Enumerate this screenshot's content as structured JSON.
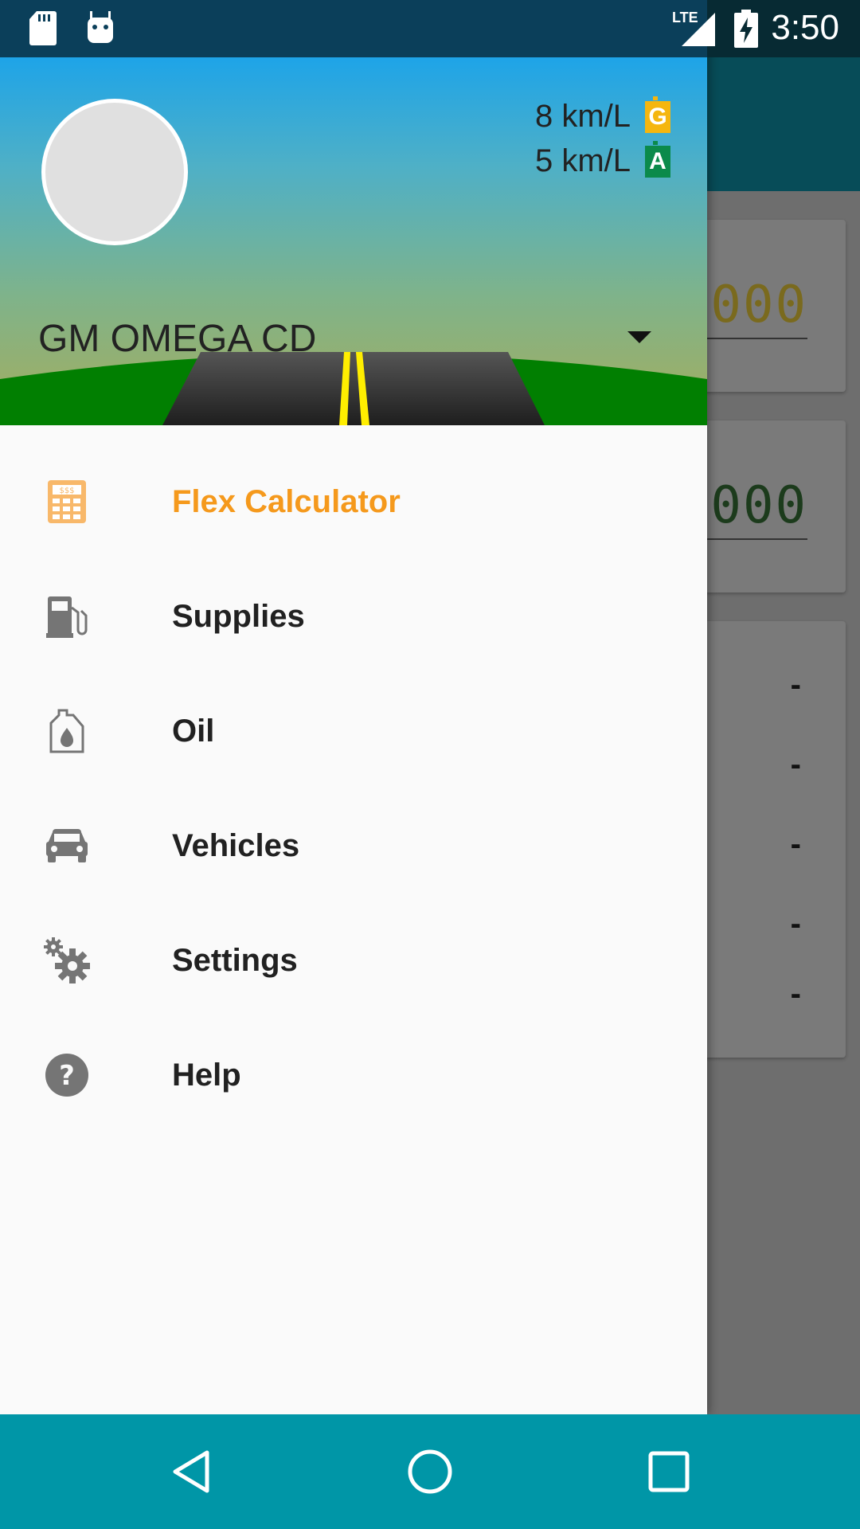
{
  "status_bar": {
    "time": "3:50",
    "network": "LTE",
    "icons": [
      "sd-card-icon",
      "android-debug-icon",
      "signal-icon",
      "battery-charging-icon"
    ]
  },
  "drawer_header": {
    "efficiency": [
      {
        "value": "8 km/L",
        "fuel": "G",
        "color": "#f5b60f"
      },
      {
        "value": "5 km/L",
        "fuel": "A",
        "color": "#0b8a4b"
      }
    ],
    "vehicle_name": "GM OMEGA CD"
  },
  "menu": {
    "items": [
      {
        "label": "Flex Calculator",
        "icon": "calculator-icon",
        "active": true
      },
      {
        "label": "Supplies",
        "icon": "gas-pump-icon",
        "active": false
      },
      {
        "label": "Oil",
        "icon": "oil-can-icon",
        "active": false
      },
      {
        "label": "Vehicles",
        "icon": "car-icon",
        "active": false
      },
      {
        "label": "Settings",
        "icon": "gears-icon",
        "active": false
      },
      {
        "label": "Help",
        "icon": "help-icon",
        "active": false
      }
    ]
  },
  "background": {
    "card1_digits": ".000",
    "card2_digits": ".000",
    "dashes": [
      "-",
      "-",
      "-",
      "-",
      "-"
    ]
  },
  "colors": {
    "accent": "#f5991c",
    "status_bar": "#0b3f5a",
    "nav_bar": "#0096a7"
  },
  "nav_bar": {
    "buttons": [
      "back-icon",
      "home-icon",
      "recents-icon"
    ]
  }
}
